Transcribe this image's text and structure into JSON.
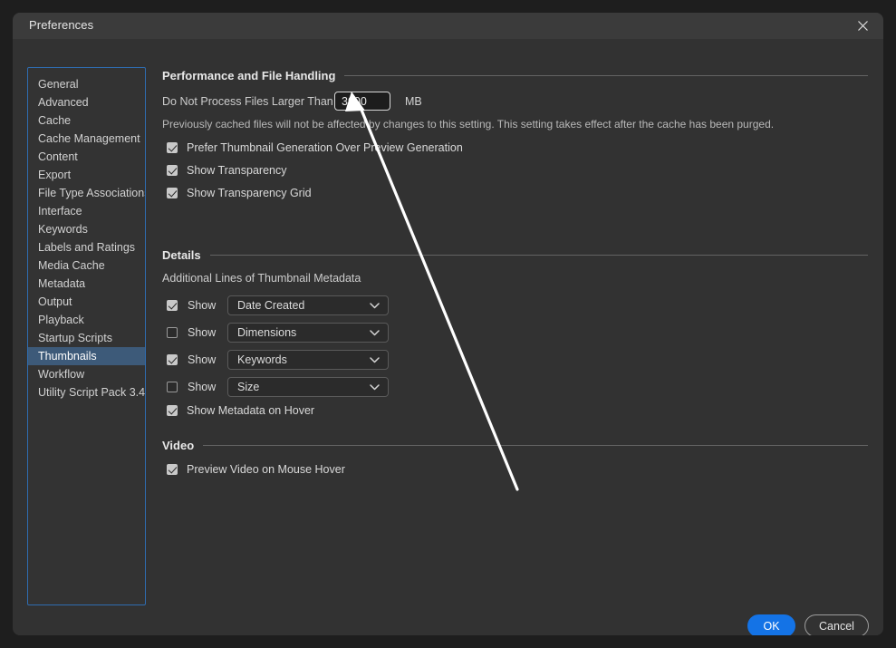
{
  "window": {
    "title": "Preferences",
    "close_icon": "close-icon"
  },
  "sidebar": {
    "items": [
      {
        "label": "General",
        "selected": false
      },
      {
        "label": "Advanced",
        "selected": false
      },
      {
        "label": "Cache",
        "selected": false
      },
      {
        "label": "Cache Management",
        "selected": false
      },
      {
        "label": "Content",
        "selected": false
      },
      {
        "label": "Export",
        "selected": false
      },
      {
        "label": "File Type Associations",
        "selected": false
      },
      {
        "label": "Interface",
        "selected": false
      },
      {
        "label": "Keywords",
        "selected": false
      },
      {
        "label": "Labels and Ratings",
        "selected": false
      },
      {
        "label": "Media Cache",
        "selected": false
      },
      {
        "label": "Metadata",
        "selected": false
      },
      {
        "label": "Output",
        "selected": false
      },
      {
        "label": "Playback",
        "selected": false
      },
      {
        "label": "Startup Scripts",
        "selected": false
      },
      {
        "label": "Thumbnails",
        "selected": true
      },
      {
        "label": "Workflow",
        "selected": false
      },
      {
        "label": "Utility Script Pack 3.4",
        "selected": false
      }
    ]
  },
  "sections": {
    "performance": {
      "heading": "Performance and File Handling",
      "size_limit_label": "Do Not Process Files Larger Than",
      "size_limit_value": "3000",
      "size_limit_unit": "MB",
      "note": "Previously cached files will not be affected by changes to this setting. This setting takes effect after the cache has been purged.",
      "checkboxes": [
        {
          "label": "Prefer Thumbnail Generation Over Preview Generation",
          "checked": true
        },
        {
          "label": "Show Transparency",
          "checked": true
        },
        {
          "label": "Show Transparency Grid",
          "checked": true
        }
      ]
    },
    "details": {
      "heading": "Details",
      "subheading": "Additional Lines of Thumbnail Metadata",
      "rows": [
        {
          "show_label": "Show",
          "checked": true,
          "value": "Date Created"
        },
        {
          "show_label": "Show",
          "checked": false,
          "value": "Dimensions"
        },
        {
          "show_label": "Show",
          "checked": true,
          "value": "Keywords"
        },
        {
          "show_label": "Show",
          "checked": false,
          "value": "Size"
        }
      ],
      "hover_checkbox": {
        "label": "Show Metadata on Hover",
        "checked": true
      }
    },
    "video": {
      "heading": "Video",
      "checkboxes": [
        {
          "label": "Preview Video on Mouse Hover",
          "checked": true
        }
      ]
    }
  },
  "footer": {
    "ok_label": "OK",
    "cancel_label": "Cancel"
  },
  "colors": {
    "accent_blue": "#1473e6",
    "selection_blue": "#3d5a79",
    "focus_border": "#2f6cb0",
    "window_bg": "#323232",
    "titlebar_bg": "#3b3b3b"
  },
  "annotation": {
    "type": "arrow",
    "points_to": "size-limit-input"
  }
}
